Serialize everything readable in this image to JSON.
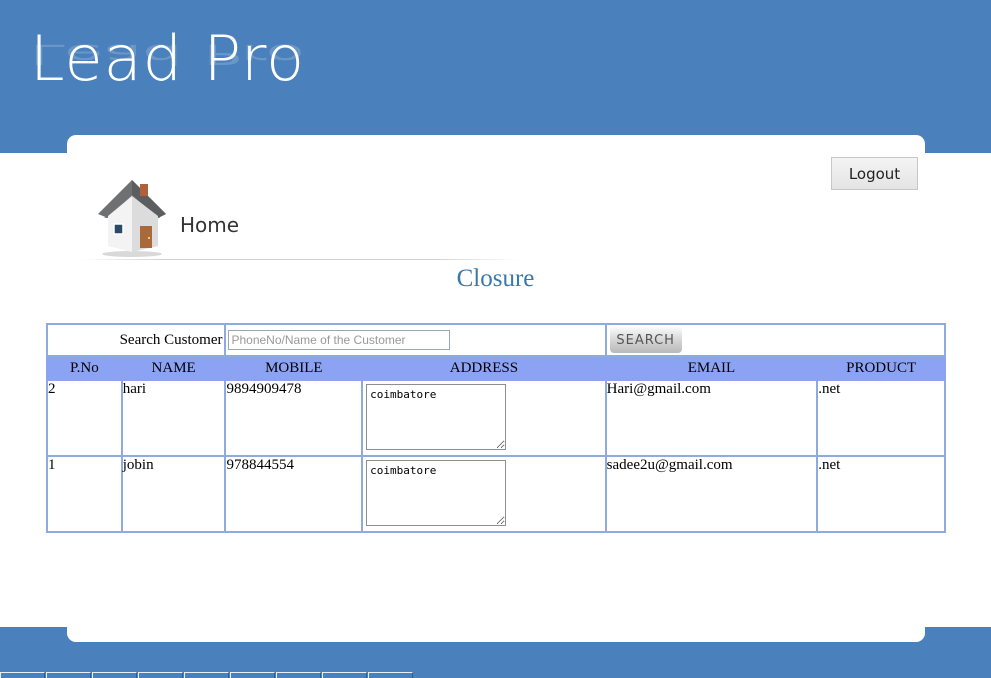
{
  "app": {
    "logo_text": "Lead Pro"
  },
  "header": {
    "logout_label": "Logout"
  },
  "breadcrumb": {
    "home_label": "Home"
  },
  "page": {
    "title": "Closure"
  },
  "search": {
    "label": "Search Customer",
    "placeholder": "PhoneNo/Name of the Customer",
    "value": "",
    "button_label": "SEARCH"
  },
  "table": {
    "columns": [
      "P.No",
      "NAME",
      "MOBILE",
      "ADDRESS",
      "EMAIL",
      "PRODUCT"
    ],
    "rows": [
      {
        "pno": "2",
        "name": "hari",
        "mobile": "9894909478",
        "address": "coimbatore",
        "email": "Hari@gmail.com",
        "product": ".net"
      },
      {
        "pno": "1",
        "name": "jobin",
        "mobile": "978844554",
        "address": "coimbatore",
        "email": "sadee2u@gmail.com",
        "product": ".net"
      }
    ]
  },
  "icons": {
    "home": "house-icon"
  },
  "colors": {
    "brand": "#4a80bb",
    "table_header": "#8ca3f4",
    "table_border": "#8eaadf",
    "title": "#3a78aa"
  }
}
